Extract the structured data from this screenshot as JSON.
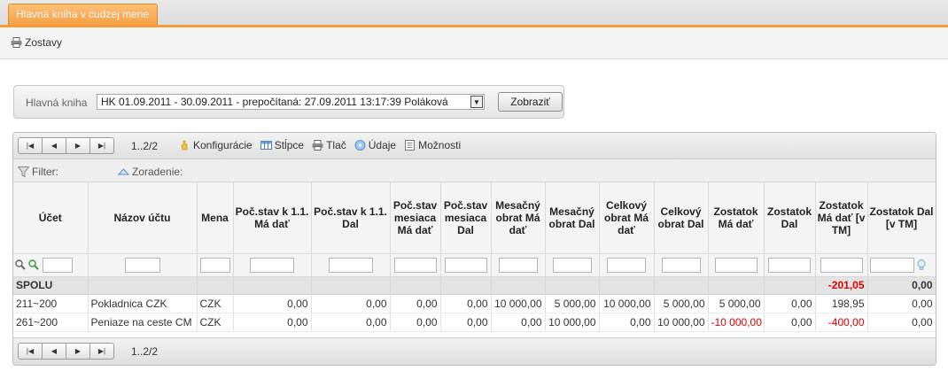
{
  "tab": {
    "label": "Hlavná kniha v cudzej mene"
  },
  "toolbar": {
    "reports_label": "Zostavy"
  },
  "filter_panel": {
    "label": "Hlavná kniha",
    "selected": "HK 01.09.2011 - 30.09.2011 - prepočítaná: 27.09.2011 13:17:39 Poláková",
    "show_button": "Zobraziť"
  },
  "grid": {
    "page_info": "1..2/2",
    "tools": {
      "config": "Konfigurácie",
      "columns": "Stĺpce",
      "print": "Tlač",
      "data": "Údaje",
      "options": "Možnosti"
    },
    "filter_label": "Filter:",
    "sort_label": "Zoradenie:",
    "headers": [
      "Účet",
      "Názov účtu",
      "Mena",
      "Poč.stav k 1.1. Má dať",
      "Poč.stav k 1.1. Dal",
      "Poč.stav mesiaca Má dať",
      "Poč.stav mesiaca Dal",
      "Mesačný obrat Má dať",
      "Mesačný obrat Dal",
      "Celkový obrat Má dať",
      "Celkový obrat Dal",
      "Zostatok Má dať",
      "Zostatok Dal",
      "Zostatok Má dať [v TM]",
      "Zostatok Dal [v TM]"
    ],
    "summary": {
      "label": "SPOLU",
      "zostatok_ma_dat_tm": "-201,05",
      "zostatok_dal_tm": "0,00"
    },
    "rows": [
      {
        "ucet": "211~200",
        "nazov": "Pokladnica CZK",
        "mena": "CZK",
        "ps_md": "0,00",
        "ps_d": "0,00",
        "psm_md": "0,00",
        "psm_d": "0,00",
        "mo_md": "10 000,00",
        "mo_d": "5 000,00",
        "co_md": "10 000,00",
        "co_d": "5 000,00",
        "z_md": "5 000,00",
        "z_d": "0,00",
        "z_md_tm": "198,95",
        "z_d_tm": "0,00"
      },
      {
        "ucet": "261~200",
        "nazov": "Peniaze na ceste CM",
        "mena": "CZK",
        "ps_md": "0,00",
        "ps_d": "0,00",
        "psm_md": "0,00",
        "psm_d": "0,00",
        "mo_md": "0,00",
        "mo_d": "10 000,00",
        "co_md": "0,00",
        "co_d": "10 000,00",
        "z_md": "-10 000,00",
        "z_d": "0,00",
        "z_md_tm": "-400,00",
        "z_d_tm": "0,00"
      }
    ],
    "footer_page_info": "1..2/2"
  },
  "colors": {
    "accent": "#f39a3b",
    "negative": "#e00000"
  }
}
